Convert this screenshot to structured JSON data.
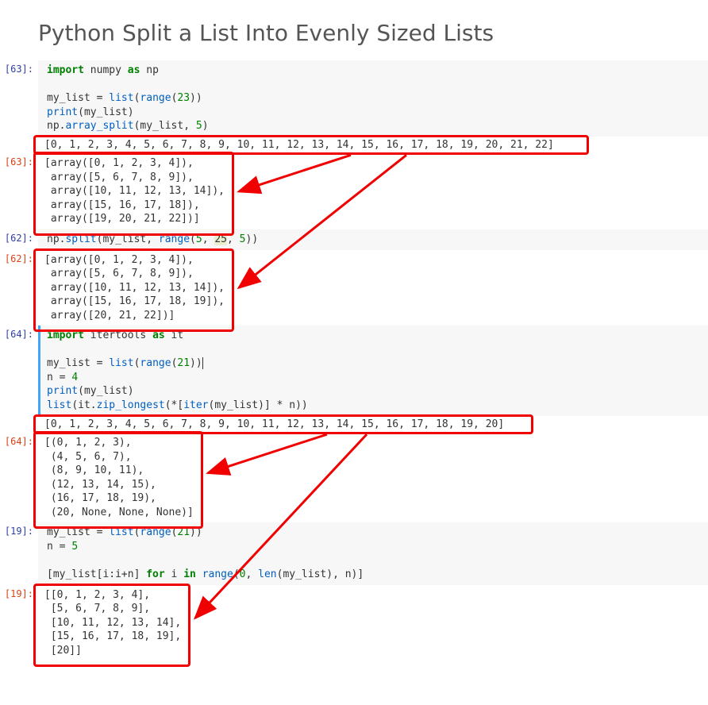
{
  "title": "Python Split a List Into Evenly Sized Lists",
  "cells": {
    "c1": {
      "prompt_in": "[63]:",
      "code_html": "<span class='kw'>import</span> numpy <span class='kw'>as</span> np\n\nmy_list = <span class='fn'>list</span>(<span class='fn'>range</span>(<span class='num'>23</span>))\n<span class='fn'>print</span>(my_list)\nnp.<span class='fn'>array_split</span>(my_list, <span class='num'>5</span>)",
      "print_out": "[0, 1, 2, 3, 4, 5, 6, 7, 8, 9, 10, 11, 12, 13, 14, 15, 16, 17, 18, 19, 20, 21, 22]",
      "prompt_out": "[63]:",
      "out": "[array([0, 1, 2, 3, 4]),\n array([5, 6, 7, 8, 9]),\n array([10, 11, 12, 13, 14]),\n array([15, 16, 17, 18]),\n array([19, 20, 21, 22])]"
    },
    "c2": {
      "prompt_in": "[62]:",
      "code_html": "np.<span class='fn'>split</span>(my_list, <span class='fn'>range</span>(<span class='num'>5</span>, <span style='background:#e8f0d0;'>25</span>, <span class='num'>5</span>))",
      "prompt_out": "[62]:",
      "out": "[array([0, 1, 2, 3, 4]),\n array([5, 6, 7, 8, 9]),\n array([10, 11, 12, 13, 14]),\n array([15, 16, 17, 18, 19]),\n array([20, 21, 22])]"
    },
    "c3": {
      "prompt_in": "[64]:",
      "code_html": "<span class='kw'>import</span> itertools <span class='kw'>as</span> it\n\nmy_list = <span class='fn' style='color:#0060c0'>list</span>(<span class='fn' style='color:#0060c0'>range</span>(<span class='num'>21</span>))<span style='border-left:1px solid #333;'></span>\nn = <span class='num'>4</span>\n<span class='fn'>print</span>(my_list)\n<span class='fn'>list</span>(it.<span class='fn'>zip_longest</span>(*[<span class='fn'>iter</span>(my_list)] * n))",
      "print_out": "[0, 1, 2, 3, 4, 5, 6, 7, 8, 9, 10, 11, 12, 13, 14, 15, 16, 17, 18, 19, 20]",
      "prompt_out": "[64]:",
      "out": "[(0, 1, 2, 3),\n (4, 5, 6, 7),\n (8, 9, 10, 11),\n (12, 13, 14, 15),\n (16, 17, 18, 19),\n (20, None, None, None)]"
    },
    "c4": {
      "prompt_in": "[19]:",
      "code_html": "my_list = <span class='fn'>list</span>(<span class='fn'>range</span>(<span class='num'>21</span>))\nn = <span class='num'>5</span>\n\n[my_list[i:i+n] <span class='kw'>for</span> i <span class='kw'>in</span> <span class='fn'>range</span>(<span class='num'>0</span>, <span class='fn'>len</span>(my_list), n)]",
      "prompt_out": "[19]:",
      "out": "[[0, 1, 2, 3, 4],\n [5, 6, 7, 8, 9],\n [10, 11, 12, 13, 14],\n [15, 16, 17, 18, 19],\n [20]]"
    }
  }
}
